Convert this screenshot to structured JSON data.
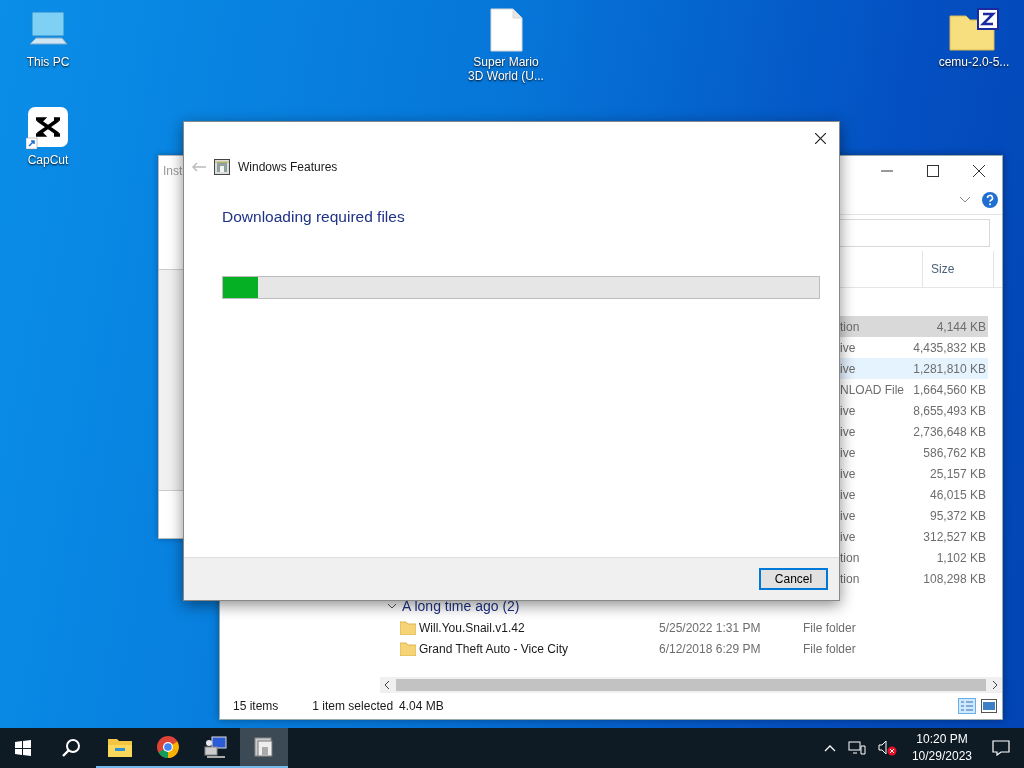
{
  "desktop": {
    "icons": [
      {
        "label": "This PC",
        "kind": "computer"
      },
      {
        "label": "CapCut",
        "kind": "shortcut"
      },
      {
        "label": "Super Mario 3D World (U...",
        "kind": "file"
      },
      {
        "label": "cemu-2.0-5...",
        "kind": "archive"
      }
    ]
  },
  "background_window": {
    "title": "Inst"
  },
  "explorer": {
    "columns": [
      {
        "label": "Size"
      }
    ],
    "rows": [
      {
        "type": "tion",
        "size": "4,144 KB",
        "selected": true,
        "hovered": false
      },
      {
        "type": "ive",
        "size": "4,435,832 KB",
        "selected": false,
        "hovered": false
      },
      {
        "type": "ive",
        "size": "1,281,810 KB",
        "selected": false,
        "hovered": true
      },
      {
        "type": "NLOAD File",
        "size": "1,664,560 KB",
        "selected": false,
        "hovered": false
      },
      {
        "type": "ive",
        "size": "8,655,493 KB",
        "selected": false,
        "hovered": false
      },
      {
        "type": "ive",
        "size": "2,736,648 KB",
        "selected": false,
        "hovered": false
      },
      {
        "type": "ive",
        "size": "586,762 KB",
        "selected": false,
        "hovered": false
      },
      {
        "type": "ive",
        "size": "25,157 KB",
        "selected": false,
        "hovered": false
      },
      {
        "type": "ive",
        "size": "46,015 KB",
        "selected": false,
        "hovered": false
      },
      {
        "type": "ive",
        "size": "95,372 KB",
        "selected": false,
        "hovered": false
      },
      {
        "type": "ive",
        "size": "312,527 KB",
        "selected": false,
        "hovered": false
      },
      {
        "type": "tion",
        "size": "1,102 KB",
        "selected": false,
        "hovered": false
      },
      {
        "type": "tion",
        "size": "108,298 KB",
        "selected": false,
        "hovered": false
      }
    ],
    "group": {
      "label": "A long time ago (2)",
      "expanded": true
    },
    "folders": [
      {
        "name": "Will.You.Snail.v1.42",
        "date": "5/25/2022 1:31 PM",
        "type": "File folder"
      },
      {
        "name": "Grand Theft Auto - Vice City",
        "date": "6/12/2018 6:29 PM",
        "type": "File folder"
      }
    ],
    "status": {
      "items": "15 items",
      "selection": "1 item selected",
      "size": "4.04 MB"
    }
  },
  "dialog": {
    "title": "Windows Features",
    "heading": "Downloading required files",
    "progress": {
      "level": 0.058
    },
    "buttons": [
      "Cancel"
    ]
  },
  "taskbar": {
    "apps": [
      {
        "kind": "explorer",
        "running": true,
        "active": false
      },
      {
        "kind": "chrome",
        "running": true,
        "active": false
      },
      {
        "kind": "setup",
        "running": true,
        "active": false
      },
      {
        "kind": "features",
        "running": true,
        "active": true
      }
    ],
    "time": "10:20 PM",
    "date": "10/29/2023"
  }
}
